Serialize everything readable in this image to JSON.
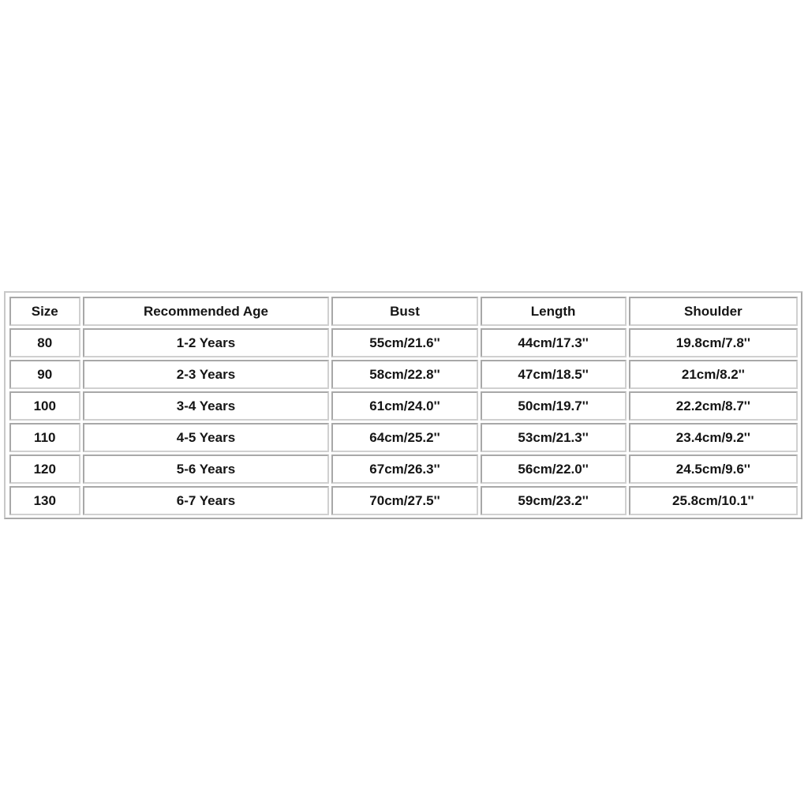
{
  "size_chart": {
    "headers": [
      "Size",
      "Recommended Age",
      "Bust",
      "Length",
      "Shoulder"
    ],
    "rows": [
      [
        "80",
        "1-2 Years",
        "55cm/21.6''",
        "44cm/17.3''",
        "19.8cm/7.8''"
      ],
      [
        "90",
        "2-3 Years",
        "58cm/22.8''",
        "47cm/18.5''",
        "21cm/8.2''"
      ],
      [
        "100",
        "3-4 Years",
        "61cm/24.0''",
        "50cm/19.7''",
        "22.2cm/8.7''"
      ],
      [
        "110",
        "4-5 Years",
        "64cm/25.2''",
        "53cm/21.3''",
        "23.4cm/9.2''"
      ],
      [
        "120",
        "5-6 Years",
        "67cm/26.3''",
        "56cm/22.0''",
        "24.5cm/9.6''"
      ],
      [
        "130",
        "6-7 Years",
        "70cm/27.5''",
        "59cm/23.2''",
        "25.8cm/10.1''"
      ]
    ]
  }
}
